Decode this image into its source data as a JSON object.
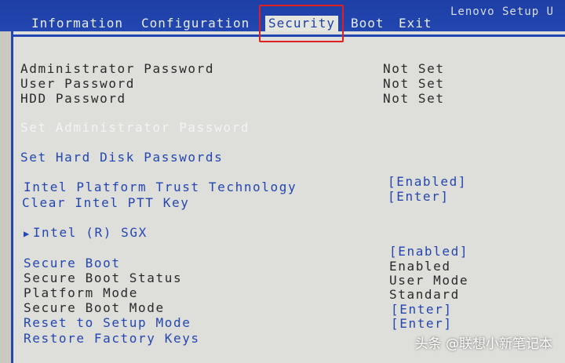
{
  "header": {
    "brand": "Lenovo Setup U",
    "tabs": [
      "Information",
      "Configuration",
      "Security",
      "Boot",
      "Exit"
    ],
    "active_tab": "Security"
  },
  "security": {
    "admin_password": {
      "label": "Administrator Password",
      "value": "Not Set"
    },
    "user_password": {
      "label": "User Password",
      "value": "Not Set"
    },
    "hdd_password": {
      "label": "HDD Password",
      "value": "Not Set"
    },
    "set_admin_password": "Set Administrator Password",
    "set_hdd_passwords": "Set Hard Disk Passwords",
    "ptt": {
      "label": "Intel Platform Trust Technology",
      "value": "[Enabled]"
    },
    "clear_ptt": {
      "label": "Clear Intel PTT Key",
      "value": "[Enter]"
    },
    "sgx": "Intel (R) SGX",
    "secure_boot": {
      "label": "Secure Boot",
      "value": "[Enabled]"
    },
    "secure_boot_status": {
      "label": "Secure Boot Status",
      "value": "Enabled"
    },
    "platform_mode": {
      "label": "Platform Mode",
      "value": "User Mode"
    },
    "secure_boot_mode": {
      "label": "Secure Boot Mode",
      "value": "Standard"
    },
    "reset_setup_mode": {
      "label": "Reset to Setup Mode",
      "value": "[Enter]"
    },
    "restore_factory_keys": {
      "label": "Restore Factory Keys",
      "value": "[Enter]"
    }
  },
  "watermark": "头条 @联想小新笔记本"
}
